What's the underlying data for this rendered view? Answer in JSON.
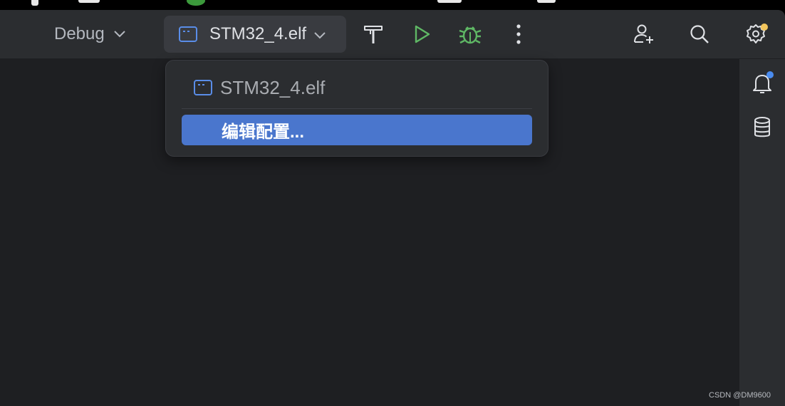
{
  "toolbar": {
    "build_config": "Debug",
    "run_config": "STM32_4.elf",
    "icons": [
      "build-hammer-icon",
      "run-icon",
      "debug-icon",
      "more-vertical-icon",
      "add-user-icon",
      "search-icon",
      "settings-icon"
    ]
  },
  "popup": {
    "items": [
      {
        "label": "STM32_4.elf",
        "icon": "run-config-icon"
      },
      {
        "label": "编辑配置..."
      }
    ]
  },
  "right_strip": {
    "icons": [
      "notifications-icon",
      "database-icon"
    ]
  },
  "colors": {
    "window_bg": "#2b2d30",
    "editor_bg": "#1e1f22",
    "accent": "#4a76cd",
    "run_green": "#5fb865",
    "notification_dot": "#4a8cf0",
    "settings_dot": "#f2c55c"
  },
  "watermark": "CSDN @DM9600"
}
